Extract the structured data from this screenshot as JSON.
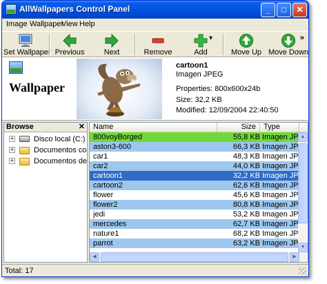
{
  "window": {
    "title": "AllWallpapers Control Panel"
  },
  "title_buttons": {
    "minimize": "_",
    "maximize": "□",
    "close": "✕"
  },
  "menu": [
    "Image",
    "Wallpaper",
    "View",
    "Help"
  ],
  "toolbar": {
    "items": [
      {
        "label": "Set Wallpaper",
        "icon": "monitor-icon"
      },
      {
        "label": "Previous",
        "icon": "arrow-left-icon"
      },
      {
        "label": "Next",
        "icon": "arrow-right-icon"
      },
      {
        "label": "Remove",
        "icon": "minus-icon"
      },
      {
        "label": "Add",
        "icon": "plus-icon"
      },
      {
        "label": "Move Up",
        "icon": "arrow-up-icon"
      },
      {
        "label": "Move Down",
        "icon": "arrow-down-icon"
      }
    ],
    "overflow": "»",
    "add_dropdown": "▾"
  },
  "preview": {
    "heading": "Wallpaper",
    "name": "cartoon1",
    "type": "Imagen JPEG",
    "properties": "Properties: 800x600x24b",
    "size": "Size: 32,2 KB",
    "modified": "Modified: 12/09/2004 22:40:50"
  },
  "browse": {
    "title": "Browse",
    "close": "✕",
    "items": [
      {
        "label": "Disco local (C:)",
        "icon": "drive-icon"
      },
      {
        "label": "Documentos compartidos",
        "icon": "folder-icon"
      },
      {
        "label": "Documentos de vmware",
        "icon": "folder-icon"
      }
    ],
    "expander": "+"
  },
  "list": {
    "columns": [
      "Name",
      "Size",
      "Type"
    ],
    "rows": [
      {
        "name": "800voyBorged",
        "size": "55,8 KB",
        "type": "Imagen JPEG",
        "state": "highlight"
      },
      {
        "name": "aston3-600",
        "size": "66,3 KB",
        "type": "Imagen JPEG",
        "state": "normal"
      },
      {
        "name": "car1",
        "size": "48,3 KB",
        "type": "Imagen JPEG",
        "state": "normal"
      },
      {
        "name": "car2",
        "size": "44,0 KB",
        "type": "Imagen JPEG",
        "state": "normal"
      },
      {
        "name": "cartoon1",
        "size": "32,2 KB",
        "type": "Imagen JPEG",
        "state": "selected"
      },
      {
        "name": "cartoon2",
        "size": "62,6 KB",
        "type": "Imagen JPEG",
        "state": "normal"
      },
      {
        "name": "flower",
        "size": "45,6 KB",
        "type": "Imagen JPEG",
        "state": "normal"
      },
      {
        "name": "flower2",
        "size": "80,8 KB",
        "type": "Imagen JPEG",
        "state": "normal"
      },
      {
        "name": "jedi",
        "size": "53,2 KB",
        "type": "Imagen JPEG",
        "state": "normal"
      },
      {
        "name": "mercedes",
        "size": "62,7 KB",
        "type": "Imagen JPEG",
        "state": "normal"
      },
      {
        "name": "nature1",
        "size": "68,2 KB",
        "type": "Imagen JPEG",
        "state": "normal"
      },
      {
        "name": "parrot",
        "size": "63,2 KB",
        "type": "Imagen JPEG",
        "state": "normal"
      }
    ]
  },
  "scroll_glyphs": {
    "up": "▲",
    "down": "▼",
    "left": "◀",
    "right": "▶"
  },
  "status": {
    "text": "Total: 17"
  },
  "colors": {
    "title_bar": "#0055e5",
    "selected_row": "#316ac5",
    "highlight_row": "#6fd83a",
    "alt_row": "#9dc7ef"
  }
}
